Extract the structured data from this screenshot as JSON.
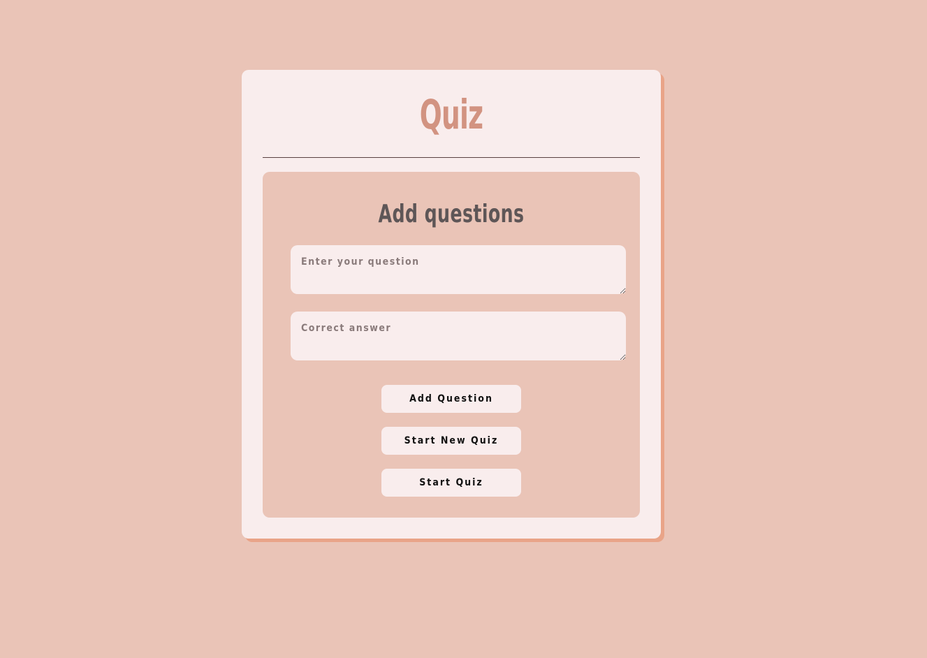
{
  "app": {
    "title": "Quiz"
  },
  "panel": {
    "heading": "Add questions",
    "question_field": {
      "placeholder": "Enter your question",
      "value": ""
    },
    "answer_field": {
      "placeholder": "Correct answer",
      "value": ""
    },
    "buttons": {
      "add_question": "Add Question",
      "start_new_quiz": "Start New Quiz",
      "start_quiz": "Start Quiz"
    }
  },
  "colors": {
    "background": "#eac4b7",
    "card": "#f9eded",
    "card_shadow": "#e9a488",
    "title": "#d29381",
    "heading": "#5e5657"
  }
}
